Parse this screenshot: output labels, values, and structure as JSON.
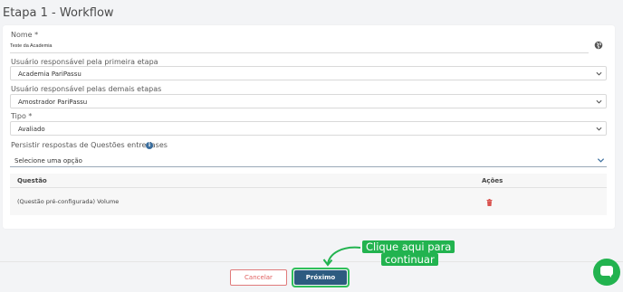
{
  "page": {
    "title": "Etapa 1 - Workflow"
  },
  "form": {
    "name": {
      "label": "Nome *",
      "value": "Teste da Academia"
    },
    "first_user": {
      "label": "Usuário responsável pela primeira etapa",
      "value": "Academia PariPassu"
    },
    "other_users": {
      "label": "Usuário responsável pelas demais etapas",
      "value": "Amostrador PariPassu"
    },
    "type": {
      "label": "Tipo *",
      "value": "Avaliado"
    },
    "persist": {
      "label": "Persistir respostas de Questões entre fases",
      "value": "Selecione uma opção"
    }
  },
  "table": {
    "headers": [
      "Questão",
      "Ações"
    ],
    "rows": [
      {
        "question": "(Questão pré-configurada) Volume"
      }
    ]
  },
  "footer": {
    "cancel_label": "Cancelar",
    "next_label": "Próximo"
  },
  "hint": {
    "line1": "Clique aqui para",
    "line2": "continuar"
  },
  "icons": {
    "name_field": "globe-icon",
    "info": "info-icon",
    "delete": "trash-icon",
    "chat": "chat-icon"
  },
  "colors": {
    "primary": "#2d5b80",
    "accent_green": "#22b34f",
    "danger": "#e06060"
  }
}
